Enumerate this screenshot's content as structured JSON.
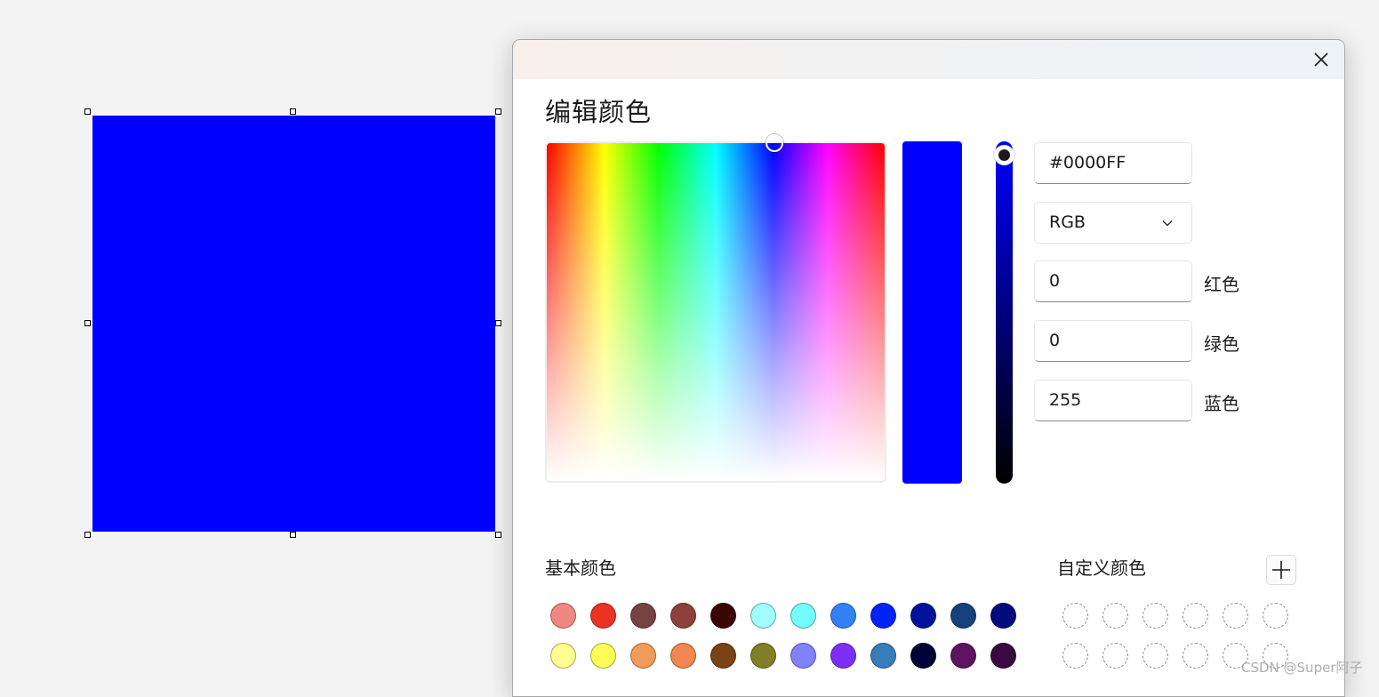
{
  "canvas": {
    "shape_color": "#0000FF"
  },
  "dialog": {
    "title": "编辑颜色",
    "close_icon": "close-icon",
    "hex_value": "#0000FF",
    "mode": "RGB",
    "channels": [
      {
        "value": "0",
        "label": "红色"
      },
      {
        "value": "0",
        "label": "绿色"
      },
      {
        "value": "255",
        "label": "蓝色"
      }
    ],
    "basic_colors_label": "基本颜色",
    "custom_colors_label": "自定义颜色",
    "add_icon": "plus-icon",
    "basic_colors": [
      "#F08783",
      "#EB3324",
      "#774342",
      "#8E403A",
      "#3A0603",
      "#A0FCFE",
      "#73FBFD",
      "#3282F6",
      "#0023F5",
      "#00129A",
      "#16417C",
      "#000C7B",
      "#FFFE91",
      "#FFFD55",
      "#F09B59",
      "#F08650",
      "#784315",
      "#817F26",
      "#7F82F8",
      "#7E2FF5",
      "#367DBA",
      "#000237",
      "#5C1461",
      "#3B0941"
    ],
    "custom_slots": 12
  },
  "watermark": "CSDN @Super阿子"
}
